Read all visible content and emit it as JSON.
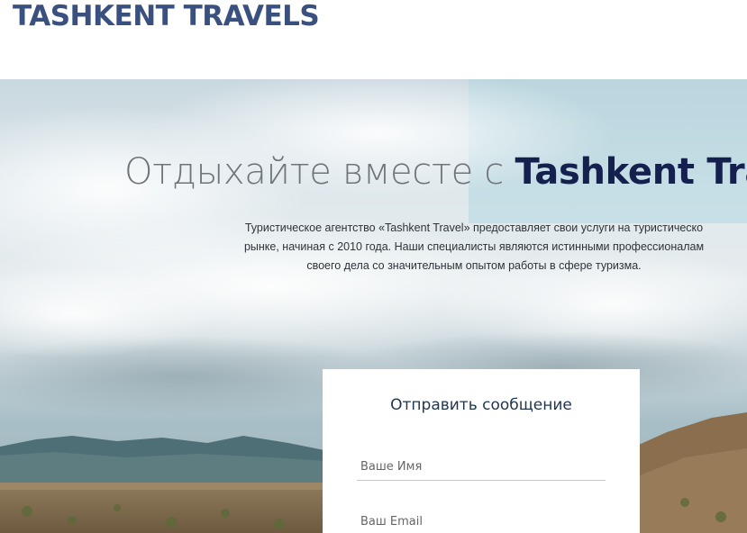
{
  "header": {
    "logo": "TASHKENT TRAVELS"
  },
  "hero": {
    "title_light": "Отдыхайте вместе с ",
    "title_brand": "Tashkent Tra",
    "description_line1": "Туристическое агентство «Tashkent Travel» предоставляет свои услуги на туристическо",
    "description_line2": "рынке, начиная с 2010 года. Наши специалисты являются истинными профессионалам",
    "description_line3": "своего дела со значительным опытом работы в сфере туризма."
  },
  "contact_form": {
    "title": "Отправить сообщение",
    "name_placeholder": "Ваше Имя",
    "email_placeholder": "Ваш Email"
  }
}
